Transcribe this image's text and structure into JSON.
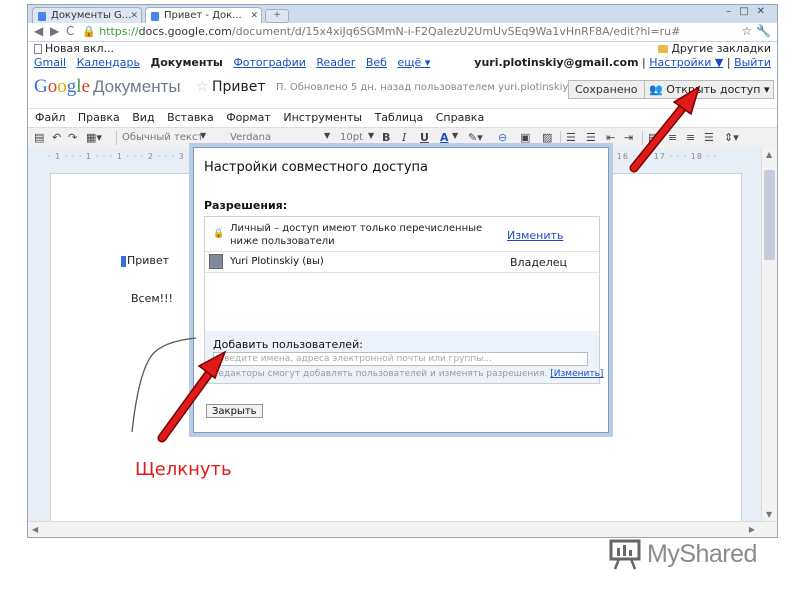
{
  "browser": {
    "tabs": [
      {
        "label": "Документы G..."
      },
      {
        "label": "Привет - Док..."
      }
    ],
    "url_secure": "https://",
    "url_host": "docs.google.com",
    "url_path": "/document/d/15x4xiJq6SGMmN-i-F2QaIezU2UmUvSEq9Wa1vHnRF8A/edit?hl=ru#",
    "bookmark_new_tab": "Новая вкл...",
    "bookmark_other": "Другие закладки"
  },
  "google_bar": {
    "links": [
      "Gmail",
      "Календарь",
      "Документы",
      "Фотографии",
      "Reader",
      "Веб",
      "ещё ▾"
    ],
    "current": "Документы",
    "email": "yuri.plotinskiy@gmail.com",
    "settings": "Настройки ▼",
    "signout": "Выйти",
    "separator": "|"
  },
  "docs_header": {
    "logo_letters": [
      "G",
      "o",
      "o",
      "g",
      "l",
      "e"
    ],
    "logo_product": "Документы",
    "doc_title": "Привет",
    "status": "П. Обновлено 5 дн. назад пользователем yuri.plotinskiy",
    "saved_button": "Сохранено",
    "share_button": "Открыть доступ ▾"
  },
  "menu": [
    "Файл",
    "Правка",
    "Вид",
    "Вставка",
    "Формат",
    "Инструменты",
    "Таблица",
    "Справка"
  ],
  "toolbar": {
    "style": "Обычный текст",
    "font": "Verdana",
    "size": "10pt",
    "bold": "B",
    "italic": "I",
    "underline": "U",
    "text_color": "A"
  },
  "document": {
    "ruler": "· 1 · · · 1 · · · 1 · · · 2 · · · 3 · · · 4 · · · 5 · · · 6 · · · 7 · · · 8 · · · 9 · · · 10 · · · 11 · · · 12 · · · 13 · · · 14 · · · 15 · · · 16 · · · 17 · · · 18 · ·",
    "greeting": "Привет",
    "line2": "Всем!!!"
  },
  "share_dialog": {
    "title": "Настройки совместного доступа",
    "permissions_label": "Разрешения:",
    "private_text": "Личный – доступ имеют только перечисленные ниже пользователи",
    "change_link": "Изменить",
    "user_name": "Yuri Plotinskiy (вы)",
    "user_role": "Владелец",
    "add_label": "Добавить пользователей:",
    "add_placeholder": "Введите имена, адреса электронной почты или группы...",
    "editors_note": "Редакторы смогут добавлять пользователей и изменять разрешения.",
    "editors_change": "[Изменить]",
    "close_button": "Закрыть"
  },
  "annotation": {
    "click_label": "Щелкнуть",
    "color": "#e01b1b"
  },
  "watermark": {
    "text": "MyShared"
  },
  "colors": {
    "link": "#1a4fbf",
    "dialog_border": "#7f99bf",
    "arrow": "#e01b1b"
  }
}
